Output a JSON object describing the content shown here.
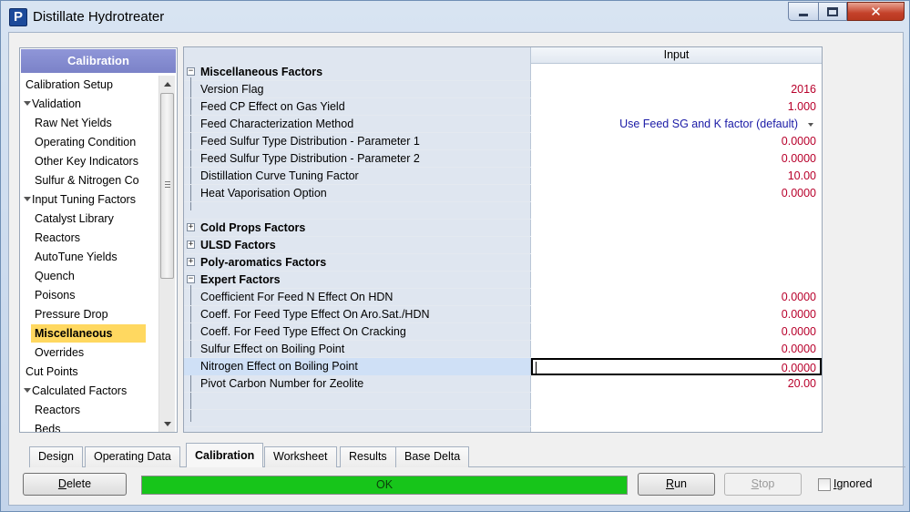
{
  "window": {
    "title": "Distillate Hydrotreater",
    "icon_letter": "P",
    "controls": {
      "minimize": "minimize-icon",
      "maximize": "maximize-icon",
      "close": "close-icon"
    }
  },
  "nav": {
    "header": "Calibration",
    "items": [
      {
        "label": "Calibration Setup"
      },
      {
        "label": "Validation"
      },
      {
        "label": "Raw Net Yields"
      },
      {
        "label": "Operating Condition"
      },
      {
        "label": "Other Key Indicators"
      },
      {
        "label": "Sulfur & Nitrogen Co"
      },
      {
        "label": "Input Tuning Factors"
      },
      {
        "label": "Catalyst Library"
      },
      {
        "label": "Reactors"
      },
      {
        "label": "AutoTune Yields"
      },
      {
        "label": "Quench"
      },
      {
        "label": "Poisons"
      },
      {
        "label": "Pressure Drop"
      },
      {
        "label": "Miscellaneous"
      },
      {
        "label": "Overrides"
      },
      {
        "label": "Cut Points"
      },
      {
        "label": "Calculated Factors"
      },
      {
        "label": "Reactors"
      },
      {
        "label": "Beds"
      }
    ],
    "selected": "Miscellaneous"
  },
  "grid": {
    "column_header": "Input",
    "sections": {
      "misc": {
        "title": "Miscellaneous Factors",
        "expander": "−",
        "rows": [
          {
            "label": "Version Flag",
            "value": "2016"
          },
          {
            "label": "Feed CP Effect on Gas Yield",
            "value": "1.000"
          },
          {
            "label": "Feed Characterization Method",
            "value": "Use Feed SG and K factor (default)"
          },
          {
            "label": "Feed Sulfur Type Distribution - Parameter 1",
            "value": "0.0000"
          },
          {
            "label": "Feed Sulfur Type Distribution - Parameter 2",
            "value": "0.0000"
          },
          {
            "label": "Distillation Curve Tuning Factor",
            "value": "10.00"
          },
          {
            "label": "Heat Vaporisation Option",
            "value": "0.0000"
          }
        ]
      },
      "cold": {
        "title": "Cold Props Factors",
        "expander": "+"
      },
      "ulsd": {
        "title": "ULSD Factors",
        "expander": "+"
      },
      "poly": {
        "title": "Poly-aromatics Factors",
        "expander": "+"
      },
      "expert": {
        "title": "Expert Factors",
        "expander": "−",
        "rows": [
          {
            "label": "Coefficient For Feed N Effect On HDN",
            "value": "0.0000"
          },
          {
            "label": "Coeff. For Feed Type Effect On Aro.Sat./HDN",
            "value": "0.0000"
          },
          {
            "label": "Coeff. For Feed Type Effect On Cracking",
            "value": "0.0000"
          },
          {
            "label": "Sulfur Effect on Boiling Point",
            "value": "0.0000"
          },
          {
            "label": "Nitrogen Effect on Boiling Point",
            "value": "0.0000"
          },
          {
            "label": "Pivot Carbon Number for Zeolite",
            "value": "20.00"
          }
        ]
      }
    }
  },
  "tabs": [
    {
      "label": "Design"
    },
    {
      "label": "Operating Data"
    },
    {
      "label": "Calibration"
    },
    {
      "label": "Worksheet"
    },
    {
      "label": "Results"
    },
    {
      "label": "Base Delta"
    }
  ],
  "active_tab": "Calibration",
  "actions": {
    "delete": {
      "first": "D",
      "rest": "elete"
    },
    "run": {
      "first": "R",
      "rest": "un"
    },
    "stop": {
      "first": "S",
      "rest": "top"
    },
    "status": "OK",
    "ignored": {
      "first": "I",
      "rest": "gnored",
      "checked": false
    }
  },
  "colors": {
    "value_text": "#b8002b",
    "dropdown_text": "#1a1aa6",
    "nav_header": "#7b82c8",
    "selected_item": "#ffd860",
    "status_ok": "#17c51a"
  }
}
